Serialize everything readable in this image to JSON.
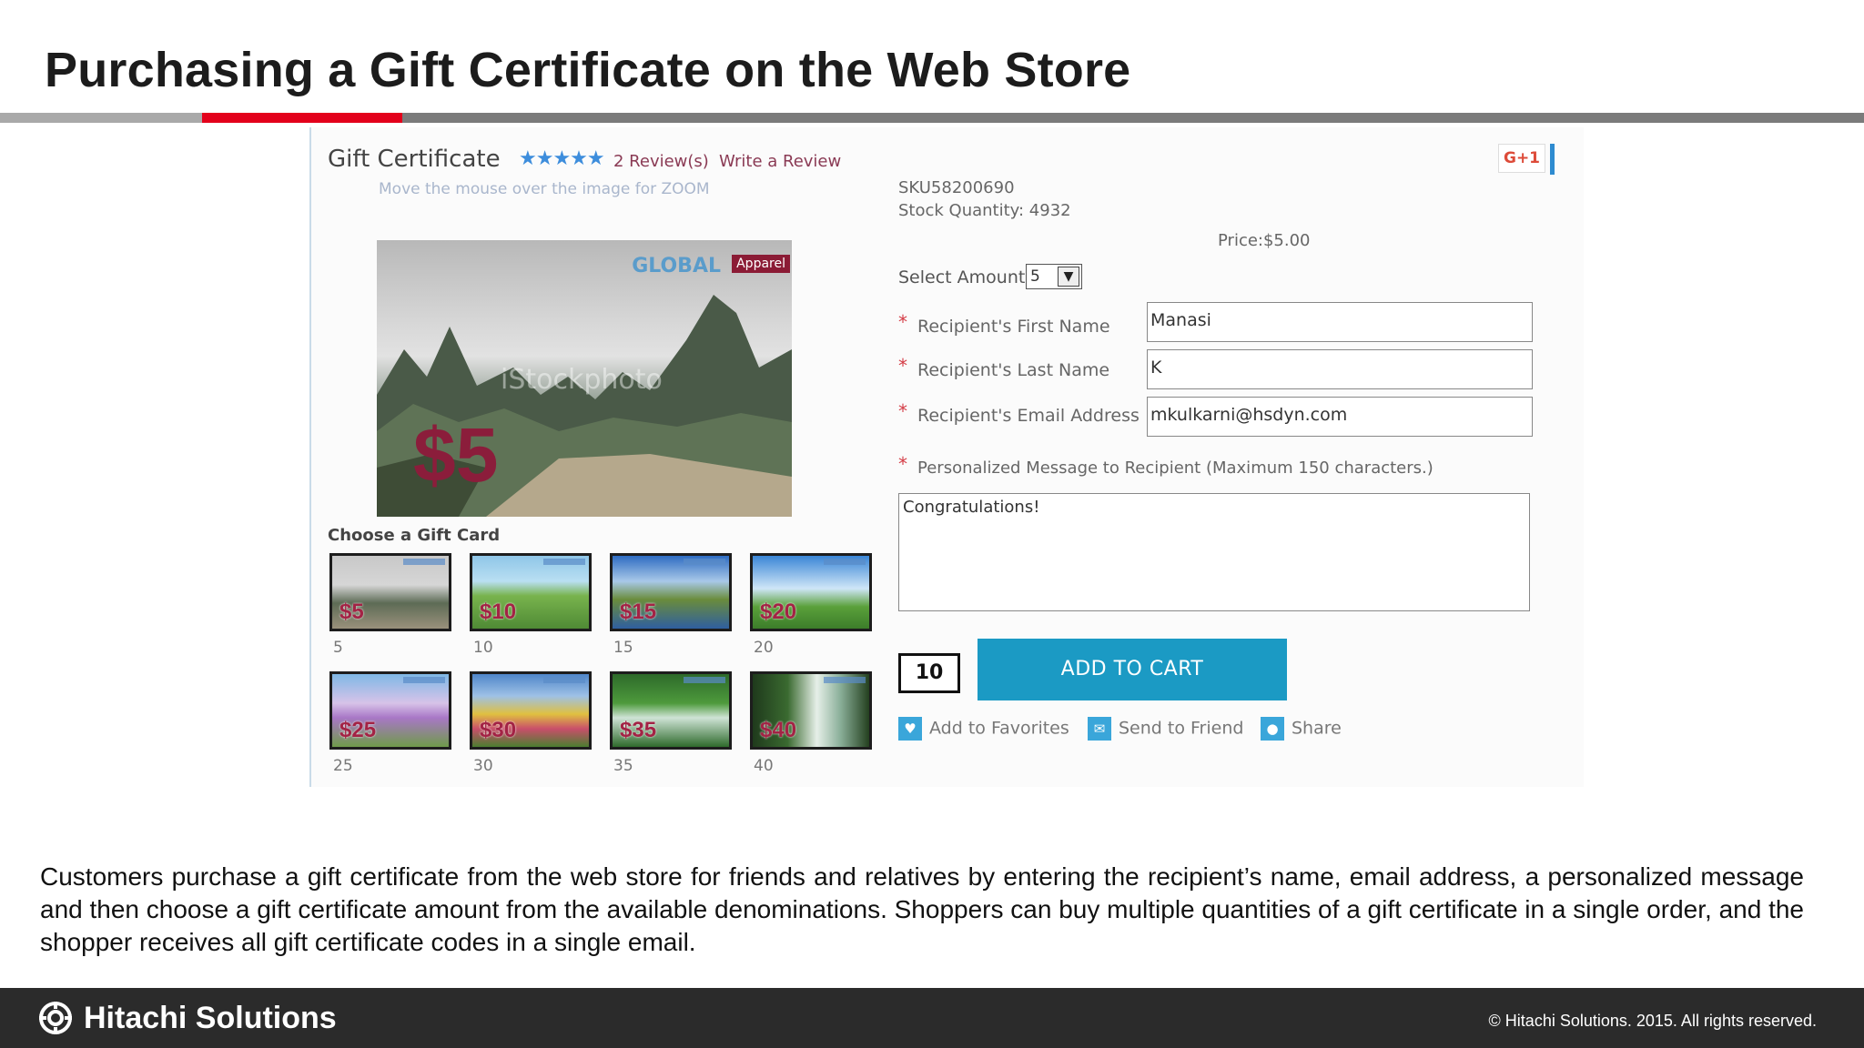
{
  "slide": {
    "title": "Purchasing a Gift Certificate on the Web Store",
    "description": "Customers purchase a gift certificate from the web store for friends and relatives by entering the recipient’s name, email address, a personalized message and then choose a gift certificate amount from the available denominations. Shoppers can buy multiple quantities of a gift certificate in a single order, and the shopper receives all gift certificate codes in a single email."
  },
  "product": {
    "title": "Gift Certificate",
    "stars": "★★★★★",
    "reviews_link": "2 Review(s)",
    "write_review_link": "Write a Review",
    "zoom_hint": "Move the mouse over the image for ZOOM",
    "image": {
      "brand": "GLOBAL",
      "brand_tag": "Apparel",
      "watermark": "iStockphoto",
      "price_overlay": "$5"
    },
    "sku": "SKU58200690",
    "stock": "Stock Quantity: 4932",
    "price": "Price:$5.00",
    "google_plus": "G+1"
  },
  "gift_cards": {
    "label": "Choose a Gift Card",
    "items": [
      {
        "price": "$5",
        "caption": "5",
        "theme": "karst"
      },
      {
        "price": "$10",
        "caption": "10",
        "theme": "meadow"
      },
      {
        "price": "$15",
        "caption": "15",
        "theme": "mountain"
      },
      {
        "price": "$20",
        "caption": "20",
        "theme": "sky"
      },
      {
        "price": "$25",
        "caption": "25",
        "theme": "lavender"
      },
      {
        "price": "$30",
        "caption": "30",
        "theme": "flowers"
      },
      {
        "price": "$35",
        "caption": "35",
        "theme": "forest"
      },
      {
        "price": "$40",
        "caption": "40",
        "theme": "waterfall"
      }
    ]
  },
  "form": {
    "required_marker": "*",
    "select_amount_label": "Select Amount",
    "select_amount_value": "5",
    "first_name_label": "Recipient's First Name",
    "first_name_value": "Manasi",
    "last_name_label": "Recipient's Last Name",
    "last_name_value": "K",
    "email_label": "Recipient's Email Address",
    "email_value": "mkulkarni@hsdyn.com",
    "message_label": "Personalized Message to Recipient  (Maximum 150 characters.)",
    "message_value": "Congratulations!",
    "quantity_value": "10",
    "add_to_cart_label": "ADD TO CART",
    "add_to_favorites_label": "Add to Favorites",
    "send_to_friend_label": "Send to Friend",
    "share_label": "Share"
  },
  "footer": {
    "company": "Hitachi Solutions",
    "copyright": "©  Hitachi Solutions. 2015. All rights reserved."
  },
  "colors": {
    "accent_red": "#e3001b",
    "cart_button": "#1b9ac4",
    "link_maroon": "#8a3a54",
    "required_red": "#d43c45",
    "footer_bg": "#2b2b2b"
  }
}
